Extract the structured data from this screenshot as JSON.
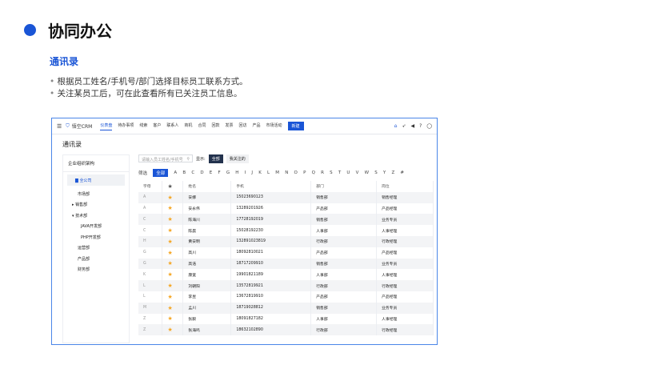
{
  "slide": {
    "title": "协同办公",
    "subtitle": "通讯录",
    "bullets": [
      "根据员工姓名/手机号/部门选择目标员工联系方式。",
      "关注某员工后，可在此查看所有已关注员工信息。"
    ]
  },
  "app": {
    "brand": "悟空CRM",
    "nav": [
      "仪表盘",
      "待办事项",
      "线索",
      "客户",
      "联系人",
      "商机",
      "合同",
      "回款",
      "发票",
      "回访",
      "产品",
      "市场活动"
    ],
    "new_label": "新建",
    "page_title": "通讯录"
  },
  "tree": {
    "header": "企业组织架构",
    "items": [
      "全公司",
      "市场部",
      "销售部",
      "技术部",
      "JAVA开发部",
      "PHP开发部",
      "运营部",
      "产品部",
      "财务部"
    ]
  },
  "toolbar": {
    "search_placeholder": "请输入员工姓名/手机号",
    "show_label": "显示:",
    "all": "全部",
    "followed": "我关注的"
  },
  "filter": {
    "label": "筛选",
    "all": "全部",
    "letters": [
      "A",
      "B",
      "C",
      "D",
      "E",
      "F",
      "G",
      "H",
      "I",
      "J",
      "K",
      "L",
      "M",
      "N",
      "O",
      "P",
      "Q",
      "R",
      "S",
      "T",
      "U",
      "V",
      "W",
      "S",
      "Y",
      "Z",
      "#"
    ]
  },
  "table": {
    "headers": [
      "字母",
      "姓名",
      "手机",
      "部门",
      "岗位"
    ],
    "rows": [
      [
        "A",
        "安娜",
        "15023690123",
        "销售部",
        "销售经理"
      ],
      [
        "A",
        "安永伟",
        "13289201926",
        "产品部",
        "产品经理"
      ],
      [
        "C",
        "陈海川",
        "17728192019",
        "销售部",
        "业务专员"
      ],
      [
        "C",
        "陈晨",
        "15028192230",
        "人事部",
        "人事经理"
      ],
      [
        "H",
        "黄安明",
        "132891023819",
        "行政部",
        "行政经理"
      ],
      [
        "G",
        "高川",
        "18092810021",
        "产品部",
        "产品经理"
      ],
      [
        "G",
        "高浩",
        "18717209910",
        "销售部",
        "业务专员"
      ],
      [
        "K",
        "康宽",
        "19901821189",
        "人事部",
        "人事经理"
      ],
      [
        "L",
        "刘朝阳",
        "13572819921",
        "行政部",
        "行政经理"
      ],
      [
        "L",
        "李昱",
        "13672819910",
        "产品部",
        "产品经理"
      ],
      [
        "M",
        "孟川",
        "18719028812",
        "销售部",
        "业务专员"
      ],
      [
        "Z",
        "张毅",
        "18091827182",
        "人事部",
        "人事经理"
      ],
      [
        "Z",
        "张海鸣",
        "18632102890",
        "行政部",
        "行政经理"
      ]
    ]
  },
  "colors": {
    "accent": "#1a55d6",
    "star": "#f5a623"
  }
}
